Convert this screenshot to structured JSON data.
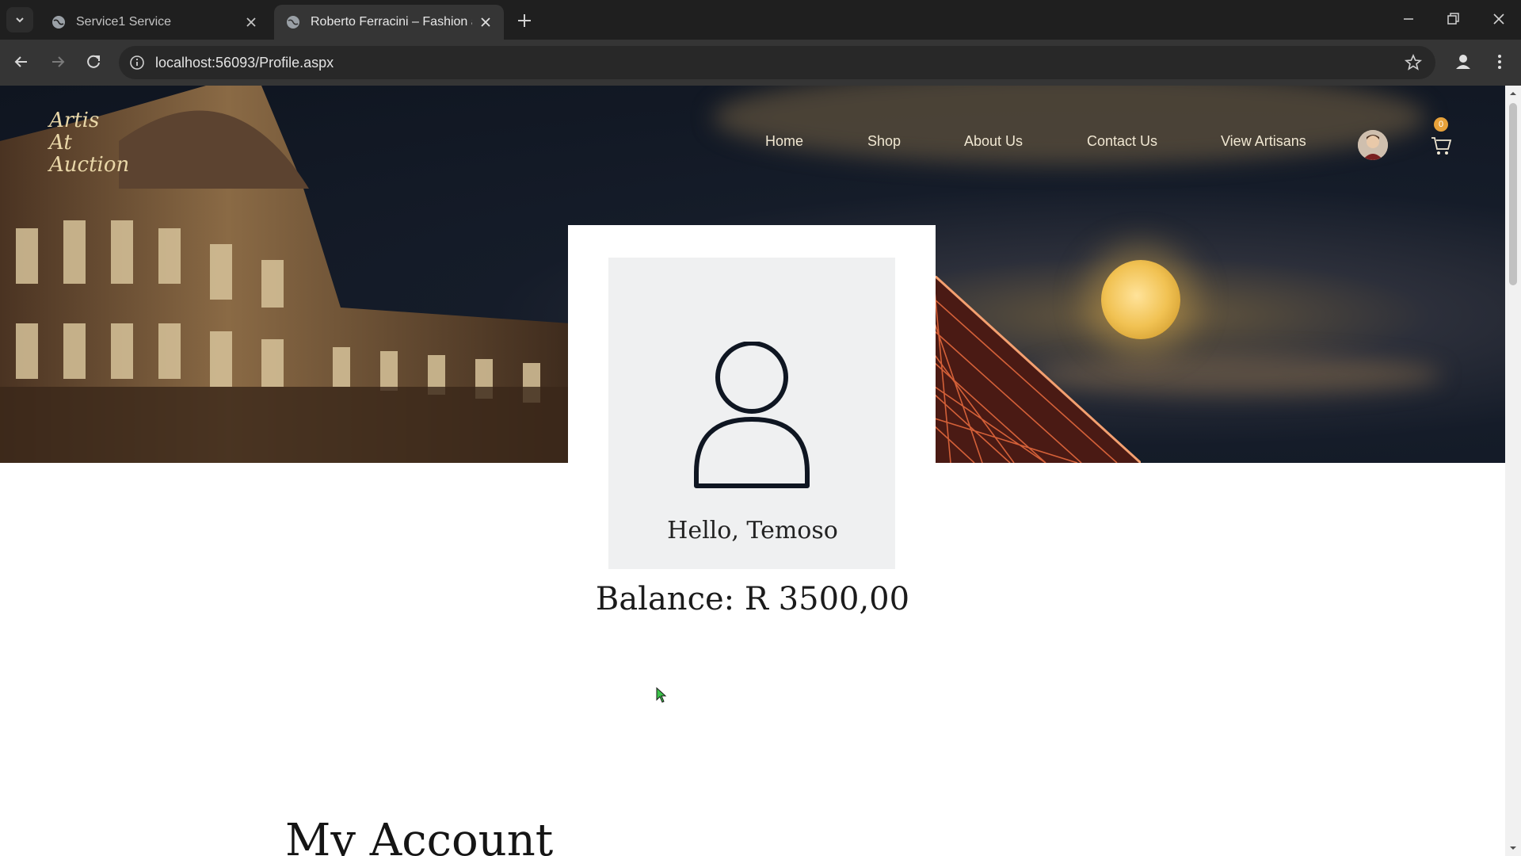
{
  "browser": {
    "tabs": [
      {
        "title": "Service1 Service",
        "active": false
      },
      {
        "title": "Roberto Ferracini – Fashion and",
        "active": true
      }
    ],
    "url": "localhost:56093/Profile.aspx"
  },
  "site": {
    "logo_lines": [
      "Artis",
      "At",
      "Auction"
    ],
    "nav": [
      "Home",
      "Shop",
      "About Us",
      "Contact Us",
      "View Artisans"
    ],
    "cart_count": "0"
  },
  "profile": {
    "greeting": "Hello, Temoso",
    "balance": "Balance: R 3500,00",
    "section_title": "My Account"
  },
  "colors": {
    "nav_text": "#f0e7d2",
    "logo_text": "#e9d7a8",
    "chrome_bg": "#1f1f1f"
  }
}
